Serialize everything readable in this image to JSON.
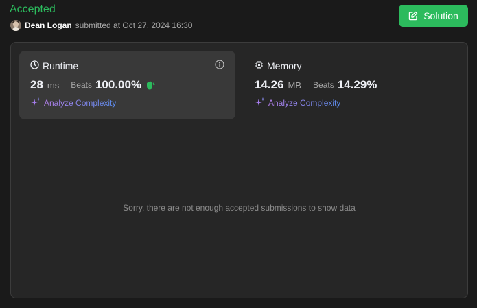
{
  "header": {
    "status": "Accepted",
    "user_name": "Dean Logan",
    "submit_info": "submitted at Oct 27, 2024 16:30",
    "solution_label": "Solution"
  },
  "runtime": {
    "title": "Runtime",
    "value": "28",
    "unit": "ms",
    "beats_label": "Beats",
    "beats_value": "100.00%",
    "analyze_label": "Analyze Complexity"
  },
  "memory": {
    "title": "Memory",
    "value": "14.26",
    "unit": "MB",
    "beats_label": "Beats",
    "beats_value": "14.29%",
    "analyze_label": "Analyze Complexity"
  },
  "chart": {
    "empty_message": "Sorry, there are not enough accepted submissions to show data"
  },
  "colors": {
    "accent_green": "#2cbb5d",
    "analyze_gradient_start": "#b37feb",
    "analyze_gradient_end": "#5b8def"
  },
  "icons": {
    "solution": "edit-note-icon",
    "runtime": "clock-icon",
    "memory": "chip-icon",
    "info": "info-icon",
    "analyze": "sparkle-icon",
    "badge": "clap-hands-icon"
  }
}
